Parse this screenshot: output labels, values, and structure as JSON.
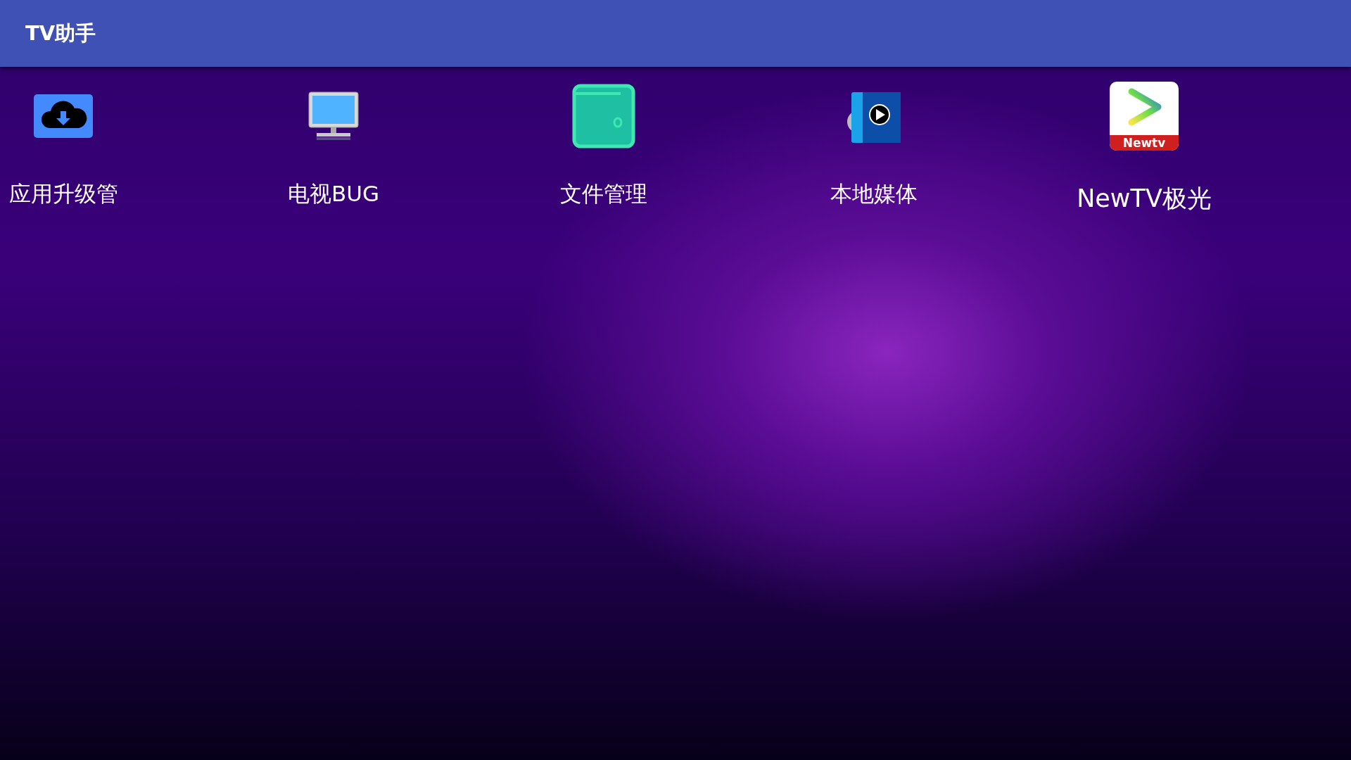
{
  "app_bar": {
    "title": "TV助手"
  },
  "apps": [
    {
      "kind": "cloud",
      "label": "应用升级管"
    },
    {
      "kind": "monitor",
      "label": "电视BUG"
    },
    {
      "kind": "wallet",
      "label": "文件管理"
    },
    {
      "kind": "media",
      "label": "本地媒体"
    },
    {
      "kind": "newtv",
      "label": "NewTV极光",
      "logo_text": "Newtv"
    }
  ]
}
